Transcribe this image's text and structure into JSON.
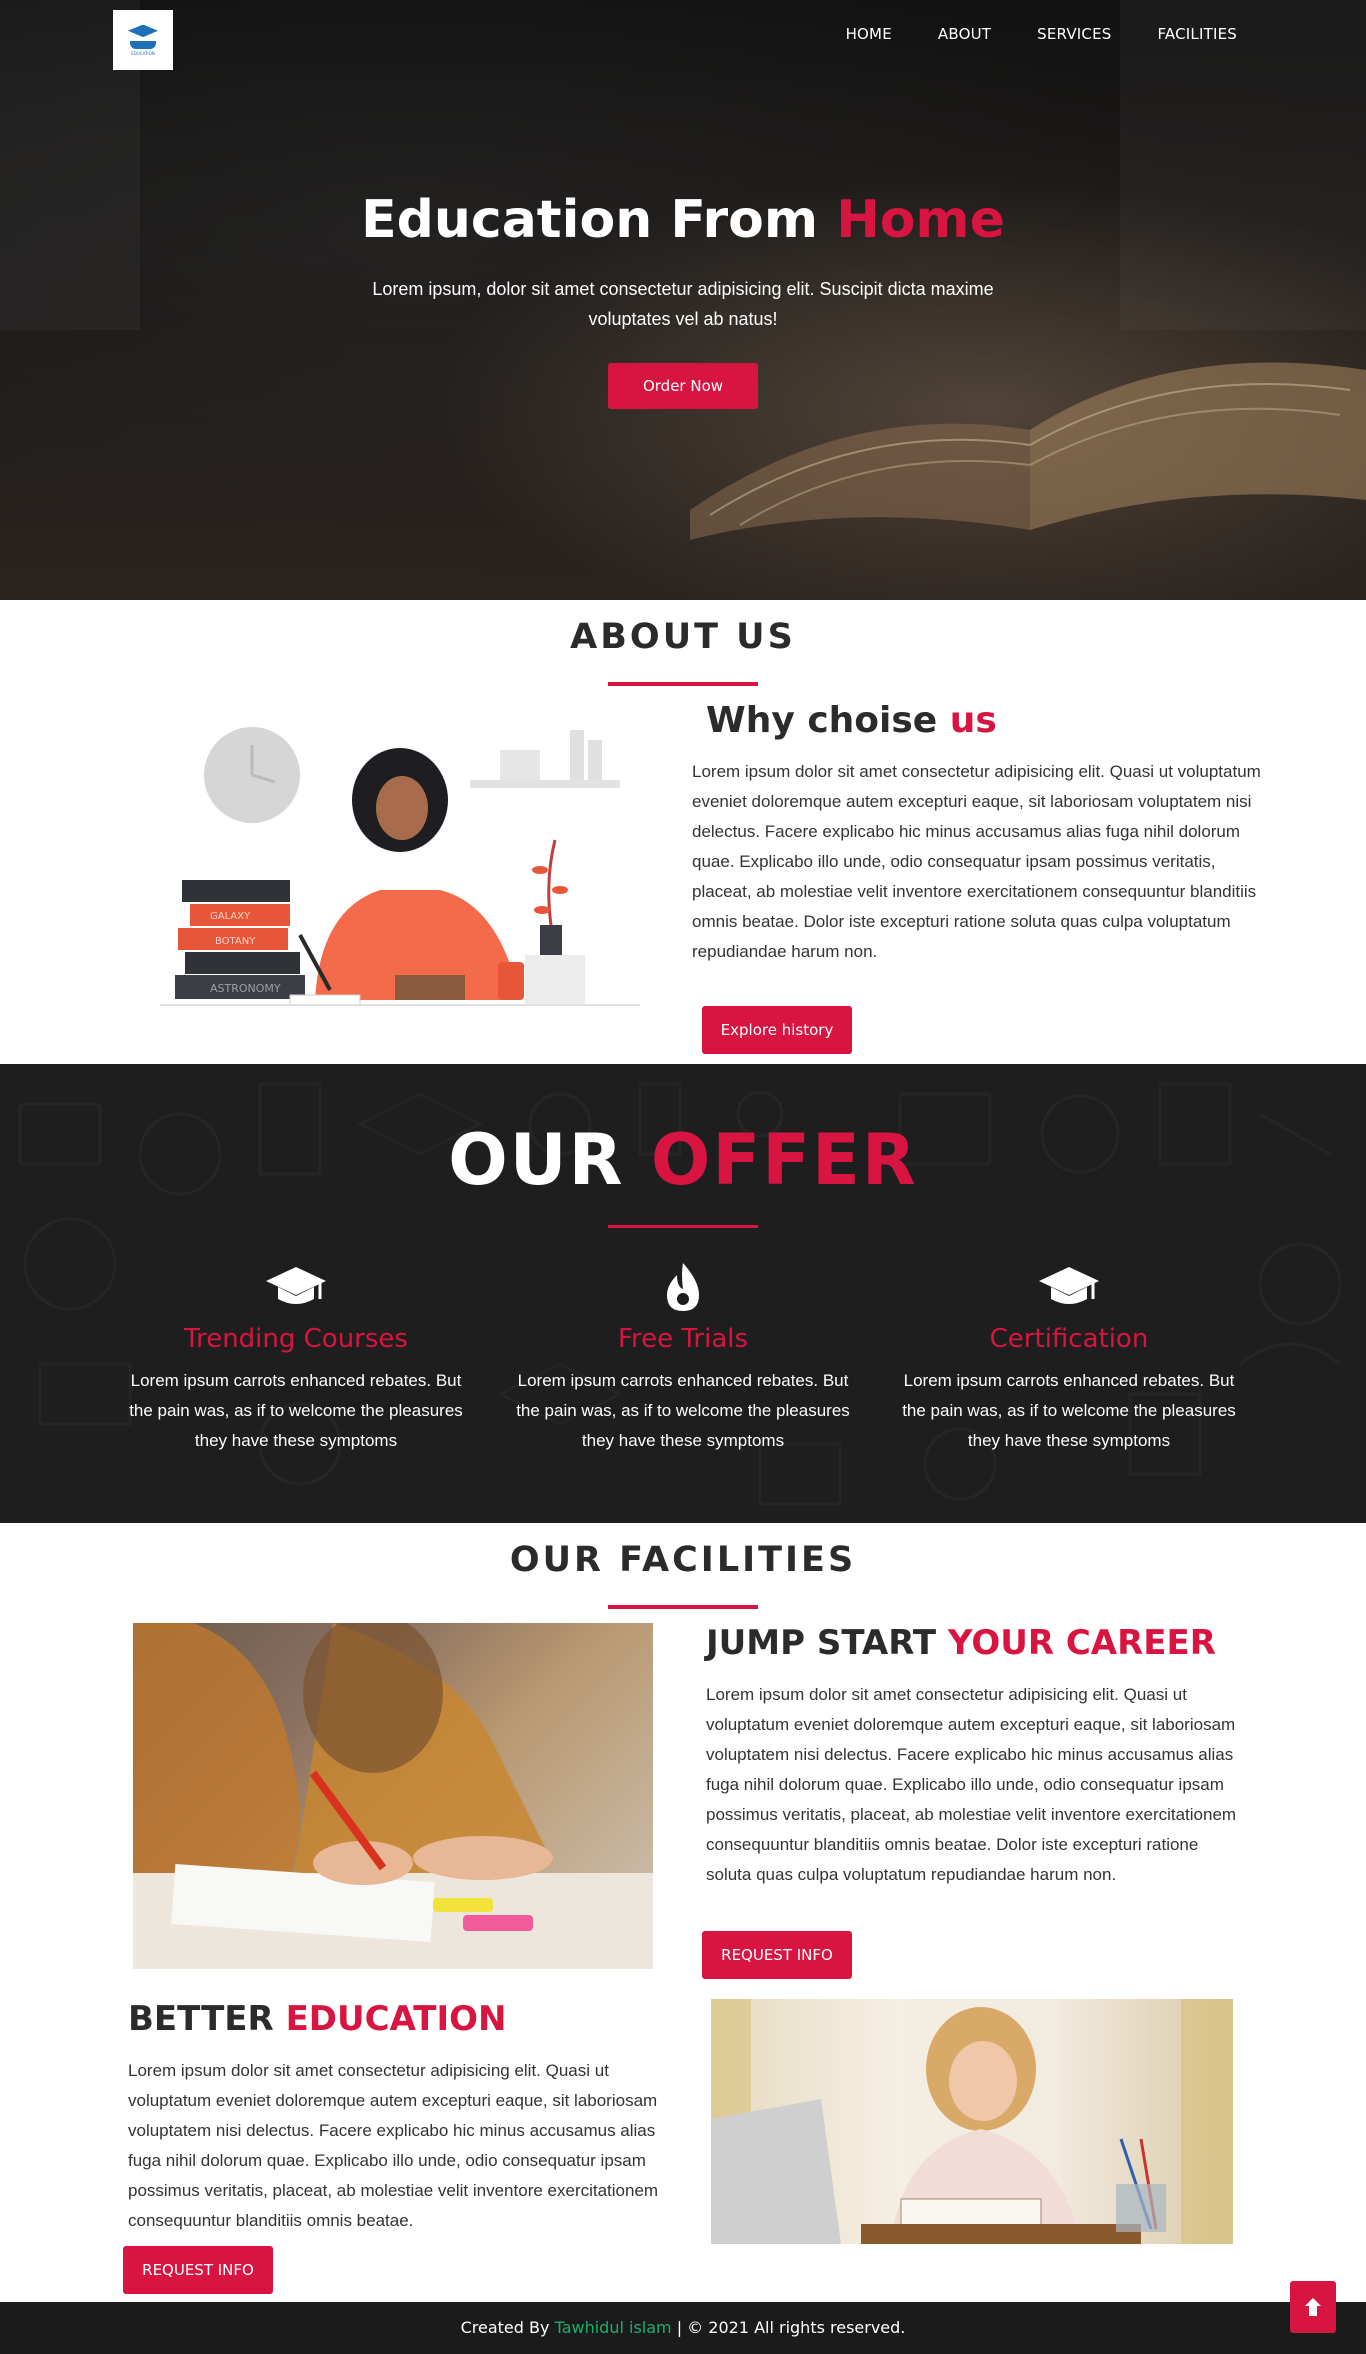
{
  "nav": {
    "logo_text": "EDUCATION",
    "links": [
      "HOME",
      "ABOUT",
      "SERVICES",
      "FACILITIES"
    ]
  },
  "hero": {
    "title_main": "Education From",
    "title_accent": "Home",
    "subtitle": "Lorem ipsum, dolor sit amet consectetur adipisicing elit. Suscipit dicta maxime voluptates vel ab natus!",
    "button": "Order Now"
  },
  "about": {
    "title": "ABOUT US",
    "sub_main": "Why choise",
    "sub_accent": "us",
    "text": "Lorem ipsum dolor sit amet consectetur adipisicing elit. Quasi ut voluptatum eveniet doloremque autem excepturi eaque, sit laboriosam voluptatem nisi delectus. Facere explicabo hic minus accusamus alias fuga nihil dolorum quae. Explicabo illo unde, odio consequatur ipsam possimus veritatis, placeat, ab molestiae velit inventore exercitationem consequuntur blanditiis omnis beatae. Dolor iste excepturi ratione soluta quas culpa voluptatum repudiandae harum non.",
    "button": "Explore history",
    "book_labels": [
      "GALAXY",
      "BOTANY",
      "ASTRONOMY"
    ]
  },
  "offer": {
    "title_main": "OUR",
    "title_accent": "OFFER",
    "items": [
      {
        "title": "Trending Courses",
        "icon": "graduation-cap-icon",
        "text": "Lorem ipsum carrots enhanced rebates. But the pain was, as if to welcome the pleasures they have these symptoms"
      },
      {
        "title": "Free Trials",
        "icon": "flame-icon",
        "text": "Lorem ipsum carrots enhanced rebates. But the pain was, as if to welcome the pleasures they have these symptoms"
      },
      {
        "title": "Certification",
        "icon": "graduation-cap-icon",
        "text": "Lorem ipsum carrots enhanced rebates. But the pain was, as if to welcome the pleasures they have these symptoms"
      }
    ]
  },
  "facilities": {
    "title": "OUR FACILITIES",
    "block1": {
      "heading_main": "JUMP START",
      "heading_accent": "YOUR CAREER",
      "text": "Lorem ipsum dolor sit amet consectetur adipisicing elit. Quasi ut voluptatum eveniet doloremque autem excepturi eaque, sit laboriosam voluptatem nisi delectus. Facere explicabo hic minus accusamus alias fuga nihil dolorum quae. Explicabo illo unde, odio consequatur ipsam possimus veritatis, placeat, ab molestiae velit inventore exercitationem consequuntur blanditiis omnis beatae. Dolor iste excepturi ratione soluta quas culpa voluptatum repudiandae harum non.",
      "button": "REQUEST INFO"
    },
    "block2": {
      "heading_main": "BETTER",
      "heading_accent": "EDUCATION",
      "text": "Lorem ipsum dolor sit amet consectetur adipisicing elit. Quasi ut voluptatum eveniet doloremque autem excepturi eaque, sit laboriosam voluptatem nisi delectus. Facere explicabo hic minus accusamus alias fuga nihil dolorum quae. Explicabo illo unde, odio consequatur ipsam possimus veritatis, placeat, ab molestiae velit inventore exercitationem consequuntur blanditiis omnis beatae.",
      "button": "REQUEST INFO"
    }
  },
  "footer": {
    "prefix": "Created By",
    "author": "Tawhidul islam",
    "suffix": "| © 2021 All rights reserved."
  },
  "colors": {
    "accent": "#d71540",
    "dark": "#1e1e1f",
    "author_green": "#18b06e"
  }
}
